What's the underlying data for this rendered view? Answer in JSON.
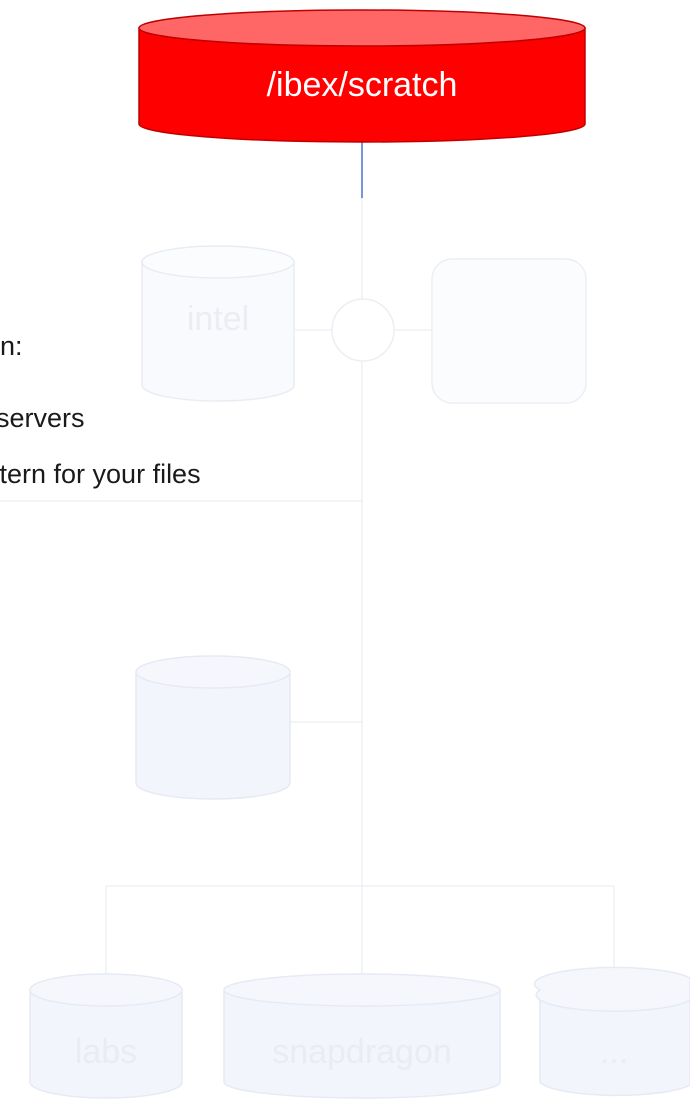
{
  "nodes": {
    "scratch": "/ibex/scratch",
    "intel": "intel",
    "labs": "labs",
    "snapdragon": "snapdragon",
    "more": "..."
  },
  "text_lines": [
    "n:",
    " servers",
    "ttern for your files"
  ],
  "colors": {
    "scratch_fill": "#ff0000",
    "scratch_top": "#ff6666",
    "scratch_stroke": "#c00000",
    "faded_fill": "#f2f5fb",
    "faded_stroke": "#e6eaf3",
    "faded_text": "#e9ecf3",
    "connector": "#4a6fd4",
    "faded_line": "#eef0f5"
  }
}
